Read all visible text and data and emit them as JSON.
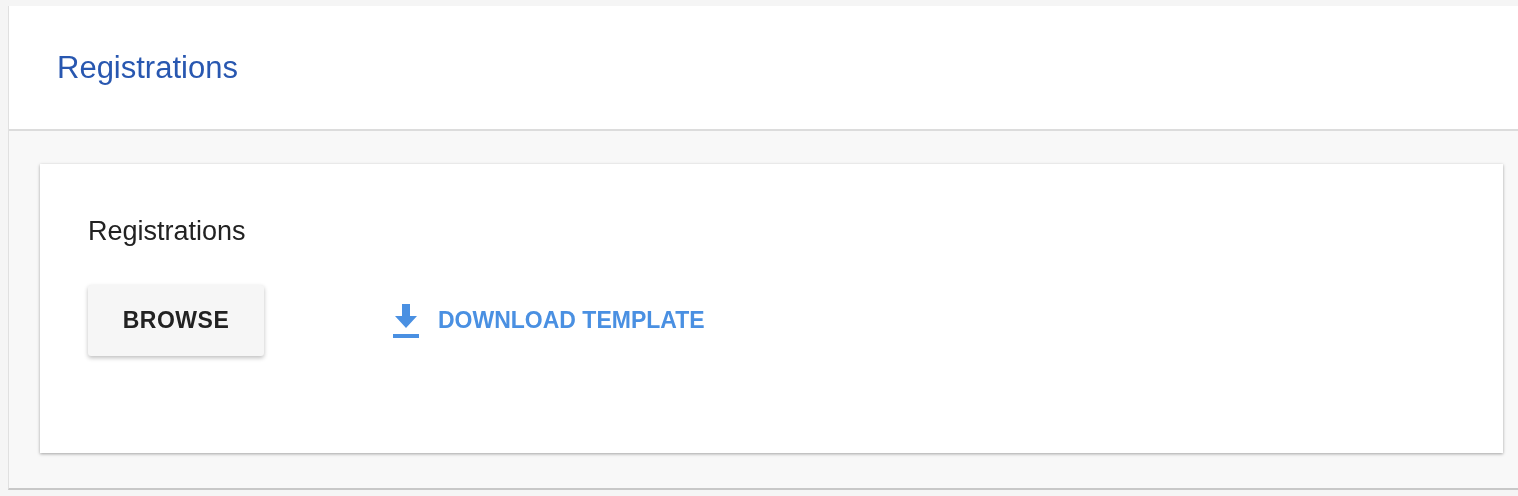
{
  "header": {
    "title": "Registrations"
  },
  "card": {
    "title": "Registrations",
    "browse_button": "BROWSE",
    "download_link": "DOWNLOAD TEMPLATE"
  }
}
